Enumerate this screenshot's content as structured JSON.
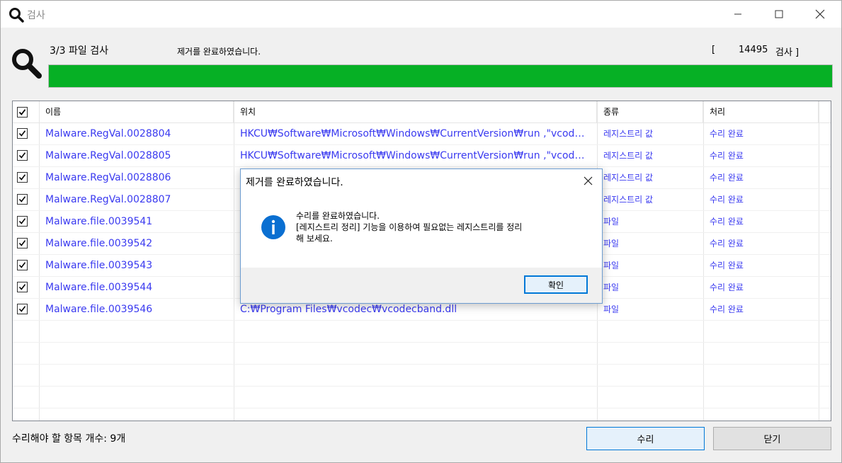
{
  "window": {
    "title": "검사",
    "controls": {
      "minimize_icon": "minimize-icon",
      "maximize_icon": "maximize-icon",
      "close_icon": "close-icon"
    }
  },
  "scan": {
    "step": "3/3 파일 검사",
    "status": "제거를 완료하였습니다.",
    "count_open": "[",
    "count_value": "14495",
    "count_suffix": "검사 ]",
    "progress_percent": 100,
    "progress_color": "#06b025"
  },
  "table": {
    "headers": {
      "name": "이름",
      "location": "위치",
      "type": "종류",
      "action": "처리"
    },
    "rows": [
      {
        "name": "Malware.RegVal.0028804",
        "location": "HKCU₩Software₩Microsoft₩Windows₩CurrentVersion₩run ,\"vcodec\"",
        "type": "레지스트리 값",
        "action": "수리 완료"
      },
      {
        "name": "Malware.RegVal.0028805",
        "location": "HKCU₩Software₩Microsoft₩Windows₩CurrentVersion₩run ,\"vcodec\"",
        "type": "레지스트리 값",
        "action": "수리 완료"
      },
      {
        "name": "Malware.RegVal.0028806",
        "location": "",
        "type": "레지스트리 값",
        "action": "수리 완료"
      },
      {
        "name": "Malware.RegVal.0028807",
        "location": "",
        "type": "레지스트리 값",
        "action": "수리 완료"
      },
      {
        "name": "Malware.file.0039541",
        "location": "",
        "type": "파일",
        "action": "수리 완료"
      },
      {
        "name": "Malware.file.0039542",
        "location": "",
        "type": "파일",
        "action": "수리 완료"
      },
      {
        "name": "Malware.file.0039543",
        "location": "",
        "type": "파일",
        "action": "수리 완료"
      },
      {
        "name": "Malware.file.0039544",
        "location": "",
        "type": "파일",
        "action": "수리 완료"
      },
      {
        "name": "Malware.file.0039546",
        "location": "C:₩Program Files₩vcodec₩vcodecband.dll",
        "type": "파일",
        "action": "수리 완료"
      }
    ],
    "link_color": "#3a3af0"
  },
  "footer": {
    "repair_count_label": "수리해야 할 항목 개수: 9개",
    "repair_button": "수리",
    "close_button": "닫기"
  },
  "dialog": {
    "title": "제거를 완료하였습니다.",
    "icon": "info-icon",
    "message_line1": "수리를 완료하였습니다.",
    "message_line2": "[레지스트리 정리] 기능을 이용하여 필요없는 레지스트리를 정리",
    "message_line3": "해 보세요.",
    "ok_button": "확인"
  }
}
